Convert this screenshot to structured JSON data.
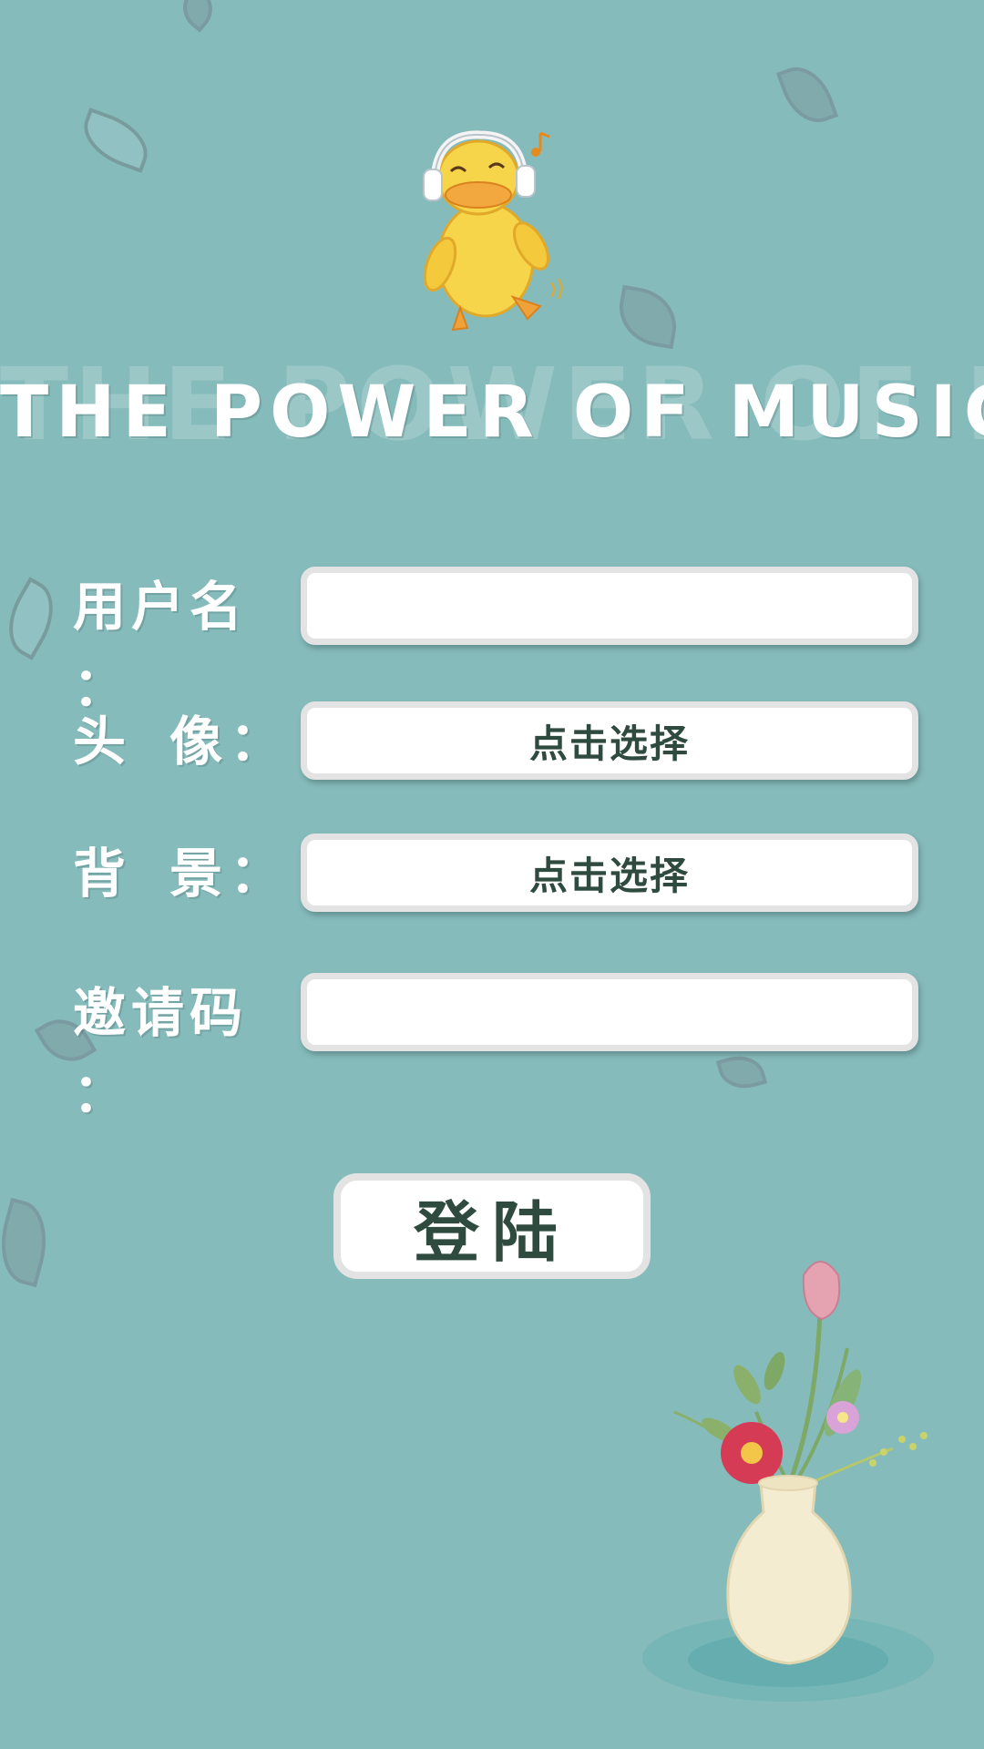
{
  "header": {
    "title": "THE POWER OF MUSIC",
    "title_shadow": "THE POWER OF MUSIC",
    "mascot_icon": "duck-with-headphones-icon"
  },
  "form": {
    "username_label_chars": [
      "用",
      "户",
      "名",
      "："
    ],
    "username_value": "",
    "avatar_label_chars": [
      "头",
      "像",
      "："
    ],
    "avatar_button": "点击选择",
    "background_label_chars": [
      "背",
      "景",
      "："
    ],
    "background_button": "点击选择",
    "invite_label_chars": [
      "邀",
      "请",
      "码",
      "："
    ],
    "invite_value": ""
  },
  "login_button": "登陆",
  "decoration": {
    "vase_icon": "flower-vase-icon",
    "leaf_icon": "leaf-icon"
  },
  "colors": {
    "background": "#86bbbb",
    "button_text": "#2f4a3f",
    "field_border": "#e3e3e3"
  }
}
